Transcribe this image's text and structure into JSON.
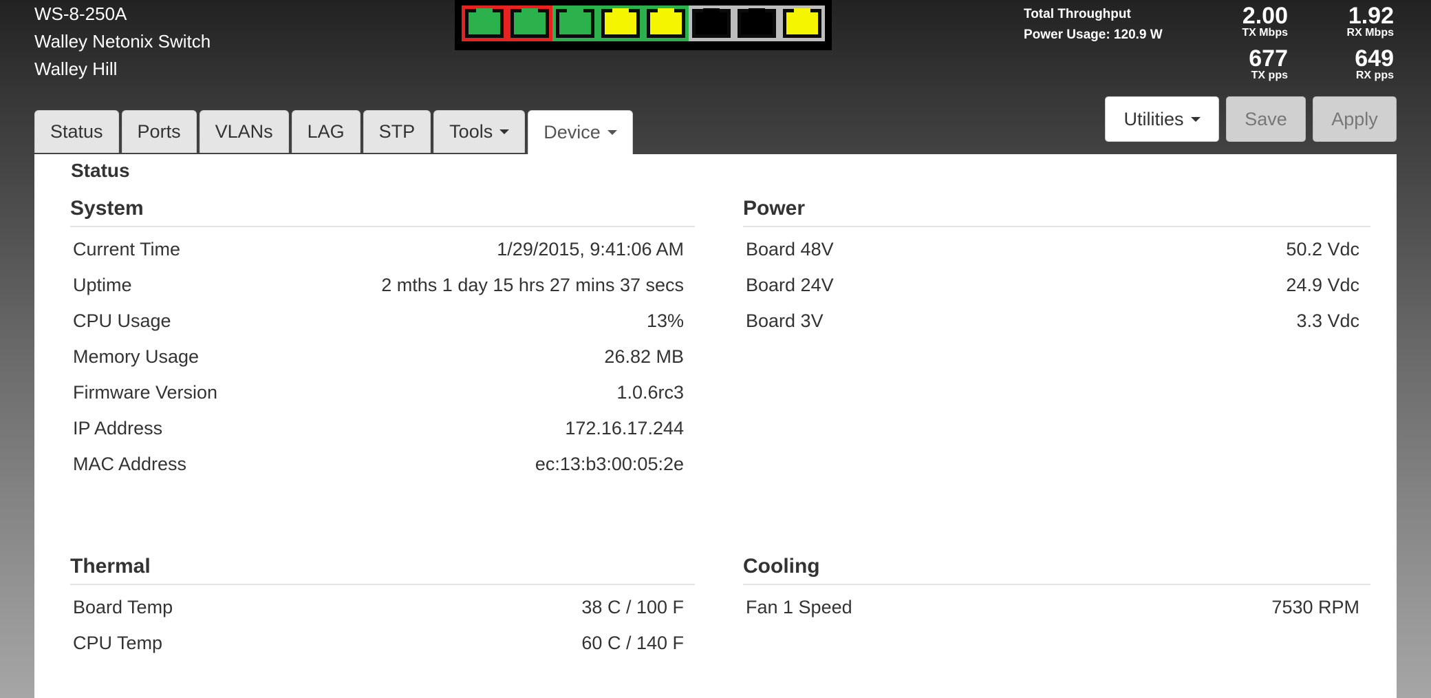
{
  "header": {
    "model": "WS-8-250A",
    "device_name": "Walley Netonix Switch",
    "location": "Walley Hill"
  },
  "ports": [
    {
      "color": "#e8231f",
      "jack": "#2bb24c"
    },
    {
      "color": "#e8231f",
      "jack": "#2bb24c"
    },
    {
      "color": "#2bb24c",
      "jack": "#2bb24c"
    },
    {
      "color": "#2bb24c",
      "jack": "#f5f500"
    },
    {
      "color": "#2bb24c",
      "jack": "#f5f500"
    },
    {
      "color": "#bdbdbd",
      "jack": "#000000"
    },
    {
      "color": "#bdbdbd",
      "jack": "#000000"
    },
    {
      "color": "#bdbdbd",
      "jack": "#f5f500"
    }
  ],
  "throughput": {
    "title": "Total Throughput",
    "power": "Power Usage: 120.9 W",
    "tx_mbps": "2.00",
    "tx_mbps_unit": "TX Mbps",
    "rx_mbps": "1.92",
    "rx_mbps_unit": "RX Mbps",
    "tx_pps": "677",
    "tx_pps_unit": "TX pps",
    "rx_pps": "649",
    "rx_pps_unit": "RX pps"
  },
  "tabs": [
    {
      "label": "Status",
      "dropdown": false,
      "active": false
    },
    {
      "label": "Ports",
      "dropdown": false,
      "active": false
    },
    {
      "label": "VLANs",
      "dropdown": false,
      "active": false
    },
    {
      "label": "LAG",
      "dropdown": false,
      "active": false
    },
    {
      "label": "STP",
      "dropdown": false,
      "active": false
    },
    {
      "label": "Tools",
      "dropdown": true,
      "active": false
    },
    {
      "label": "Device",
      "dropdown": true,
      "active": true
    }
  ],
  "actions": {
    "utilities": "Utilities",
    "save": "Save",
    "apply": "Apply"
  },
  "page_title": "Status",
  "system": {
    "title": "System",
    "rows": [
      {
        "label": "Current Time",
        "value": "1/29/2015, 9:41:06 AM"
      },
      {
        "label": "Uptime",
        "value": "2 mths 1 day 15 hrs 27 mins 37 secs"
      },
      {
        "label": "CPU Usage",
        "value": "13%"
      },
      {
        "label": "Memory Usage",
        "value": "26.82 MB"
      },
      {
        "label": "Firmware Version",
        "value": "1.0.6rc3"
      },
      {
        "label": "IP Address",
        "value": "172.16.17.244"
      },
      {
        "label": "MAC Address",
        "value": "ec:13:b3:00:05:2e"
      }
    ]
  },
  "power": {
    "title": "Power",
    "rows": [
      {
        "label": "Board 48V",
        "value": "50.2 Vdc"
      },
      {
        "label": "Board 24V",
        "value": "24.9 Vdc"
      },
      {
        "label": "Board 3V",
        "value": "3.3 Vdc"
      }
    ]
  },
  "thermal": {
    "title": "Thermal",
    "rows": [
      {
        "label": "Board Temp",
        "value": "38 C / 100 F"
      },
      {
        "label": "CPU Temp",
        "value": "60 C / 140 F"
      }
    ]
  },
  "cooling": {
    "title": "Cooling",
    "rows": [
      {
        "label": "Fan 1 Speed",
        "value": "7530 RPM"
      }
    ]
  }
}
